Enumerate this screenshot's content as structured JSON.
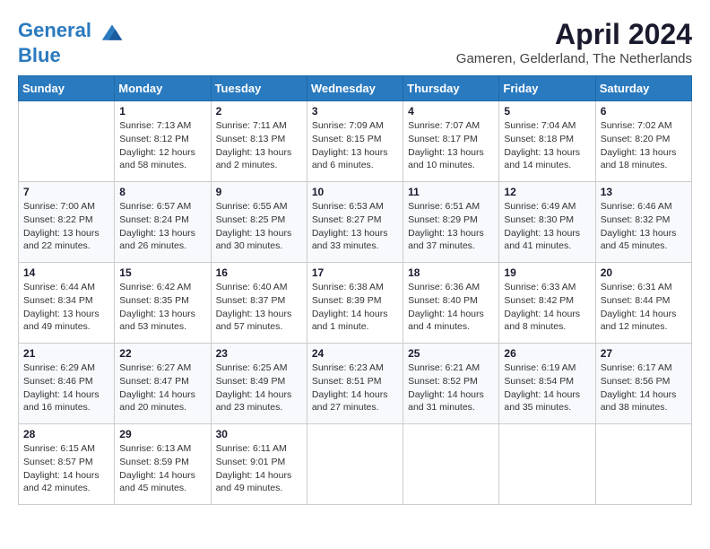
{
  "header": {
    "logo_line1": "General",
    "logo_line2": "Blue",
    "month_year": "April 2024",
    "location": "Gameren, Gelderland, The Netherlands"
  },
  "weekdays": [
    "Sunday",
    "Monday",
    "Tuesday",
    "Wednesday",
    "Thursday",
    "Friday",
    "Saturday"
  ],
  "weeks": [
    [
      {
        "day": "",
        "info": ""
      },
      {
        "day": "1",
        "info": "Sunrise: 7:13 AM\nSunset: 8:12 PM\nDaylight: 12 hours\nand 58 minutes."
      },
      {
        "day": "2",
        "info": "Sunrise: 7:11 AM\nSunset: 8:13 PM\nDaylight: 13 hours\nand 2 minutes."
      },
      {
        "day": "3",
        "info": "Sunrise: 7:09 AM\nSunset: 8:15 PM\nDaylight: 13 hours\nand 6 minutes."
      },
      {
        "day": "4",
        "info": "Sunrise: 7:07 AM\nSunset: 8:17 PM\nDaylight: 13 hours\nand 10 minutes."
      },
      {
        "day": "5",
        "info": "Sunrise: 7:04 AM\nSunset: 8:18 PM\nDaylight: 13 hours\nand 14 minutes."
      },
      {
        "day": "6",
        "info": "Sunrise: 7:02 AM\nSunset: 8:20 PM\nDaylight: 13 hours\nand 18 minutes."
      }
    ],
    [
      {
        "day": "7",
        "info": "Sunrise: 7:00 AM\nSunset: 8:22 PM\nDaylight: 13 hours\nand 22 minutes."
      },
      {
        "day": "8",
        "info": "Sunrise: 6:57 AM\nSunset: 8:24 PM\nDaylight: 13 hours\nand 26 minutes."
      },
      {
        "day": "9",
        "info": "Sunrise: 6:55 AM\nSunset: 8:25 PM\nDaylight: 13 hours\nand 30 minutes."
      },
      {
        "day": "10",
        "info": "Sunrise: 6:53 AM\nSunset: 8:27 PM\nDaylight: 13 hours\nand 33 minutes."
      },
      {
        "day": "11",
        "info": "Sunrise: 6:51 AM\nSunset: 8:29 PM\nDaylight: 13 hours\nand 37 minutes."
      },
      {
        "day": "12",
        "info": "Sunrise: 6:49 AM\nSunset: 8:30 PM\nDaylight: 13 hours\nand 41 minutes."
      },
      {
        "day": "13",
        "info": "Sunrise: 6:46 AM\nSunset: 8:32 PM\nDaylight: 13 hours\nand 45 minutes."
      }
    ],
    [
      {
        "day": "14",
        "info": "Sunrise: 6:44 AM\nSunset: 8:34 PM\nDaylight: 13 hours\nand 49 minutes."
      },
      {
        "day": "15",
        "info": "Sunrise: 6:42 AM\nSunset: 8:35 PM\nDaylight: 13 hours\nand 53 minutes."
      },
      {
        "day": "16",
        "info": "Sunrise: 6:40 AM\nSunset: 8:37 PM\nDaylight: 13 hours\nand 57 minutes."
      },
      {
        "day": "17",
        "info": "Sunrise: 6:38 AM\nSunset: 8:39 PM\nDaylight: 14 hours\nand 1 minute."
      },
      {
        "day": "18",
        "info": "Sunrise: 6:36 AM\nSunset: 8:40 PM\nDaylight: 14 hours\nand 4 minutes."
      },
      {
        "day": "19",
        "info": "Sunrise: 6:33 AM\nSunset: 8:42 PM\nDaylight: 14 hours\nand 8 minutes."
      },
      {
        "day": "20",
        "info": "Sunrise: 6:31 AM\nSunset: 8:44 PM\nDaylight: 14 hours\nand 12 minutes."
      }
    ],
    [
      {
        "day": "21",
        "info": "Sunrise: 6:29 AM\nSunset: 8:46 PM\nDaylight: 14 hours\nand 16 minutes."
      },
      {
        "day": "22",
        "info": "Sunrise: 6:27 AM\nSunset: 8:47 PM\nDaylight: 14 hours\nand 20 minutes."
      },
      {
        "day": "23",
        "info": "Sunrise: 6:25 AM\nSunset: 8:49 PM\nDaylight: 14 hours\nand 23 minutes."
      },
      {
        "day": "24",
        "info": "Sunrise: 6:23 AM\nSunset: 8:51 PM\nDaylight: 14 hours\nand 27 minutes."
      },
      {
        "day": "25",
        "info": "Sunrise: 6:21 AM\nSunset: 8:52 PM\nDaylight: 14 hours\nand 31 minutes."
      },
      {
        "day": "26",
        "info": "Sunrise: 6:19 AM\nSunset: 8:54 PM\nDaylight: 14 hours\nand 35 minutes."
      },
      {
        "day": "27",
        "info": "Sunrise: 6:17 AM\nSunset: 8:56 PM\nDaylight: 14 hours\nand 38 minutes."
      }
    ],
    [
      {
        "day": "28",
        "info": "Sunrise: 6:15 AM\nSunset: 8:57 PM\nDaylight: 14 hours\nand 42 minutes."
      },
      {
        "day": "29",
        "info": "Sunrise: 6:13 AM\nSunset: 8:59 PM\nDaylight: 14 hours\nand 45 minutes."
      },
      {
        "day": "30",
        "info": "Sunrise: 6:11 AM\nSunset: 9:01 PM\nDaylight: 14 hours\nand 49 minutes."
      },
      {
        "day": "",
        "info": ""
      },
      {
        "day": "",
        "info": ""
      },
      {
        "day": "",
        "info": ""
      },
      {
        "day": "",
        "info": ""
      }
    ]
  ]
}
